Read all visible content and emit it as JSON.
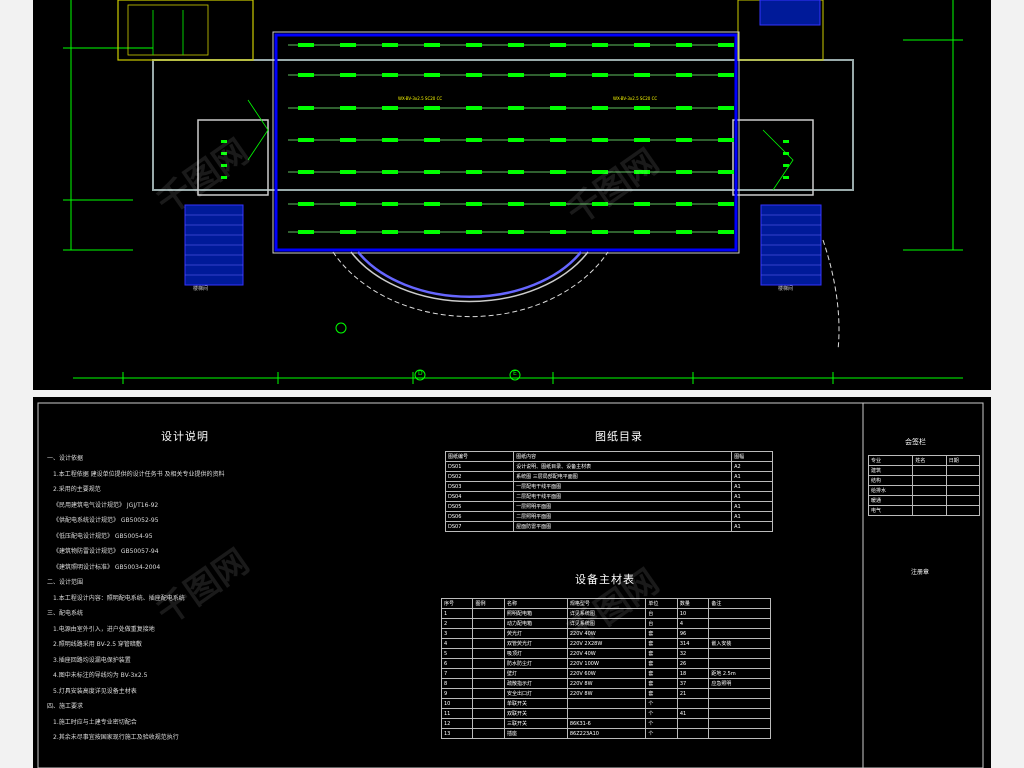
{
  "plan": {
    "labels": {
      "stair_left": "楼梯间",
      "stair_right": "楼梯间",
      "note_left": "WX-BV-3x2.5 SC20 CC",
      "note_right": "WX-BV-3x2.5 SC20 CC",
      "axis_a": "D",
      "axis_b": "E"
    }
  },
  "sheet": {
    "design_notes": {
      "title": "设计说明",
      "lines": [
        "一、设计依据",
        "1.本工程依据  建设单位提供的设计任务书  及相关专业提供的资料",
        "2.采用的主要规范",
        "《民用建筑电气设计规范》    JGJ/T16-92",
        "《供配电系统设计规范》      GB50052-95",
        "《低压配电设计规范》        GB50054-95",
        "《建筑物防雷设计规范》      GB50057-94",
        "《建筑照明设计标准》        GB50034-2004",
        "二、设计范围",
        "1.本工程设计内容：照明配电系统、插座配电系统",
        "三、配电系统",
        "1.电源由室外引入，进户处做重复接地",
        "2.照明线路采用 BV-2.5 穿管暗敷",
        "3.插座回路均设漏电保护装置",
        "4.图中未标注的导线均为 BV-3x2.5",
        "5.灯具安装高度详见设备主材表",
        "四、施工要求",
        "1.施工时应与土建专业密切配合",
        "2.其余未尽事宜按国家现行施工及验收规范执行"
      ]
    },
    "drawing_list": {
      "title": "图纸目录",
      "headers": [
        "图纸编号",
        "图纸内容",
        "图幅"
      ],
      "rows": [
        [
          "DS01",
          "设计说明、图纸目录、设备主材表",
          "A2"
        ],
        [
          "DS02",
          "系统图      三层局部配电平面图",
          "A1"
        ],
        [
          "DS03",
          "一层配电干线平面图",
          "A1"
        ],
        [
          "DS04",
          "二层配电干线平面图",
          "A1"
        ],
        [
          "DS05",
          "一层照明平面图",
          "A1"
        ],
        [
          "DS06",
          "二层照明平面图",
          "A1"
        ],
        [
          "DS07",
          "屋面防雷平面图",
          "A1"
        ]
      ]
    },
    "equipment": {
      "title": "设备主材表",
      "headers": [
        "序号",
        "图例",
        "名称",
        "规格型号",
        "单位",
        "数量",
        "备注"
      ],
      "rows": [
        [
          "1",
          "",
          "照明配电箱",
          "详见系统图",
          "台",
          "10",
          ""
        ],
        [
          "2",
          "",
          "动力配电箱",
          "详见系统图",
          "台",
          "4",
          ""
        ],
        [
          "3",
          "",
          "荧光灯",
          "220V 40W",
          "套",
          "96",
          ""
        ],
        [
          "4",
          "",
          "双管荧光灯",
          "220V 2X28W",
          "套",
          "314",
          "嵌入安装"
        ],
        [
          "5",
          "",
          "吸顶灯",
          "220V 40W",
          "套",
          "32",
          ""
        ],
        [
          "6",
          "",
          "防水防尘灯",
          "220V 100W",
          "套",
          "26",
          ""
        ],
        [
          "7",
          "",
          "壁灯",
          "220V 60W",
          "套",
          "18",
          "距地 2.5m"
        ],
        [
          "8",
          "",
          "疏散指示灯",
          "220V 8W",
          "套",
          "37",
          "应急照明"
        ],
        [
          "9",
          "",
          "安全出口灯",
          "220V 8W",
          "套",
          "21",
          ""
        ],
        [
          "10",
          "",
          "单联开关",
          "",
          "个",
          "",
          ""
        ],
        [
          "11",
          "",
          "双联开关",
          "",
          "个",
          "41",
          ""
        ],
        [
          "12",
          "",
          "三联开关",
          "86K31-6",
          "个",
          "",
          ""
        ],
        [
          "13",
          "",
          "插座",
          "86Z223A10",
          "个",
          "",
          ""
        ]
      ]
    },
    "signoff": {
      "title": "会签栏",
      "headers": [
        "专业",
        "姓名",
        "日期"
      ],
      "rows": [
        "建筑",
        "结构",
        "给排水",
        "暖通",
        "电气"
      ],
      "stamp": "注册章"
    }
  }
}
